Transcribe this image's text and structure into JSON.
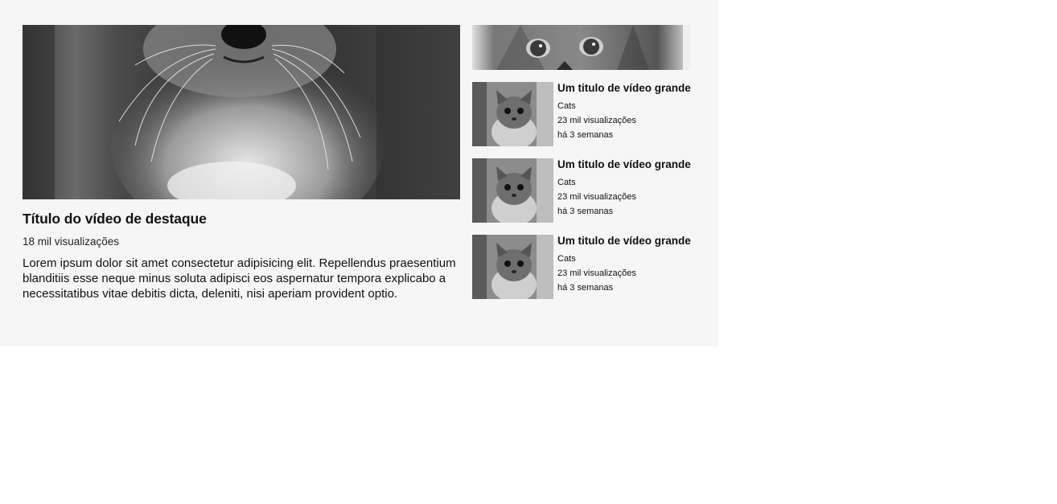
{
  "featured": {
    "title": "Título do vídeo de destaque",
    "views": "18 mil visualizações",
    "description": "Lorem ipsum dolor sit amet consectetur adipisicing elit. Repellendus praesentium blanditiis esse neque minus soluta adipisci eos aspernatur tempora explicabo a necessitatibus vitae debitis dicta, deleniti, nisi aperiam provident optio."
  },
  "videos": [
    {
      "title": "Um titulo de vídeo grande",
      "channel": "Cats",
      "views": "23 mil visualizações",
      "age": "há 3 semanas"
    },
    {
      "title": "Um titulo de vídeo grande",
      "channel": "Cats",
      "views": "23 mil visualizações",
      "age": "há 3 semanas"
    },
    {
      "title": "Um titulo de vídeo grande",
      "channel": "Cats",
      "views": "23 mil visualizações",
      "age": "há 3 semanas"
    }
  ],
  "colors": {
    "panel_bg": "#f6f6f6",
    "page_bg": "#ffffff",
    "text": "#111111"
  },
  "icons": {
    "featured_image": "kitten-closeup-photo",
    "banner_image": "kitten-eyes-photo",
    "thumb_image": "kitten-thumbnail-photo"
  }
}
